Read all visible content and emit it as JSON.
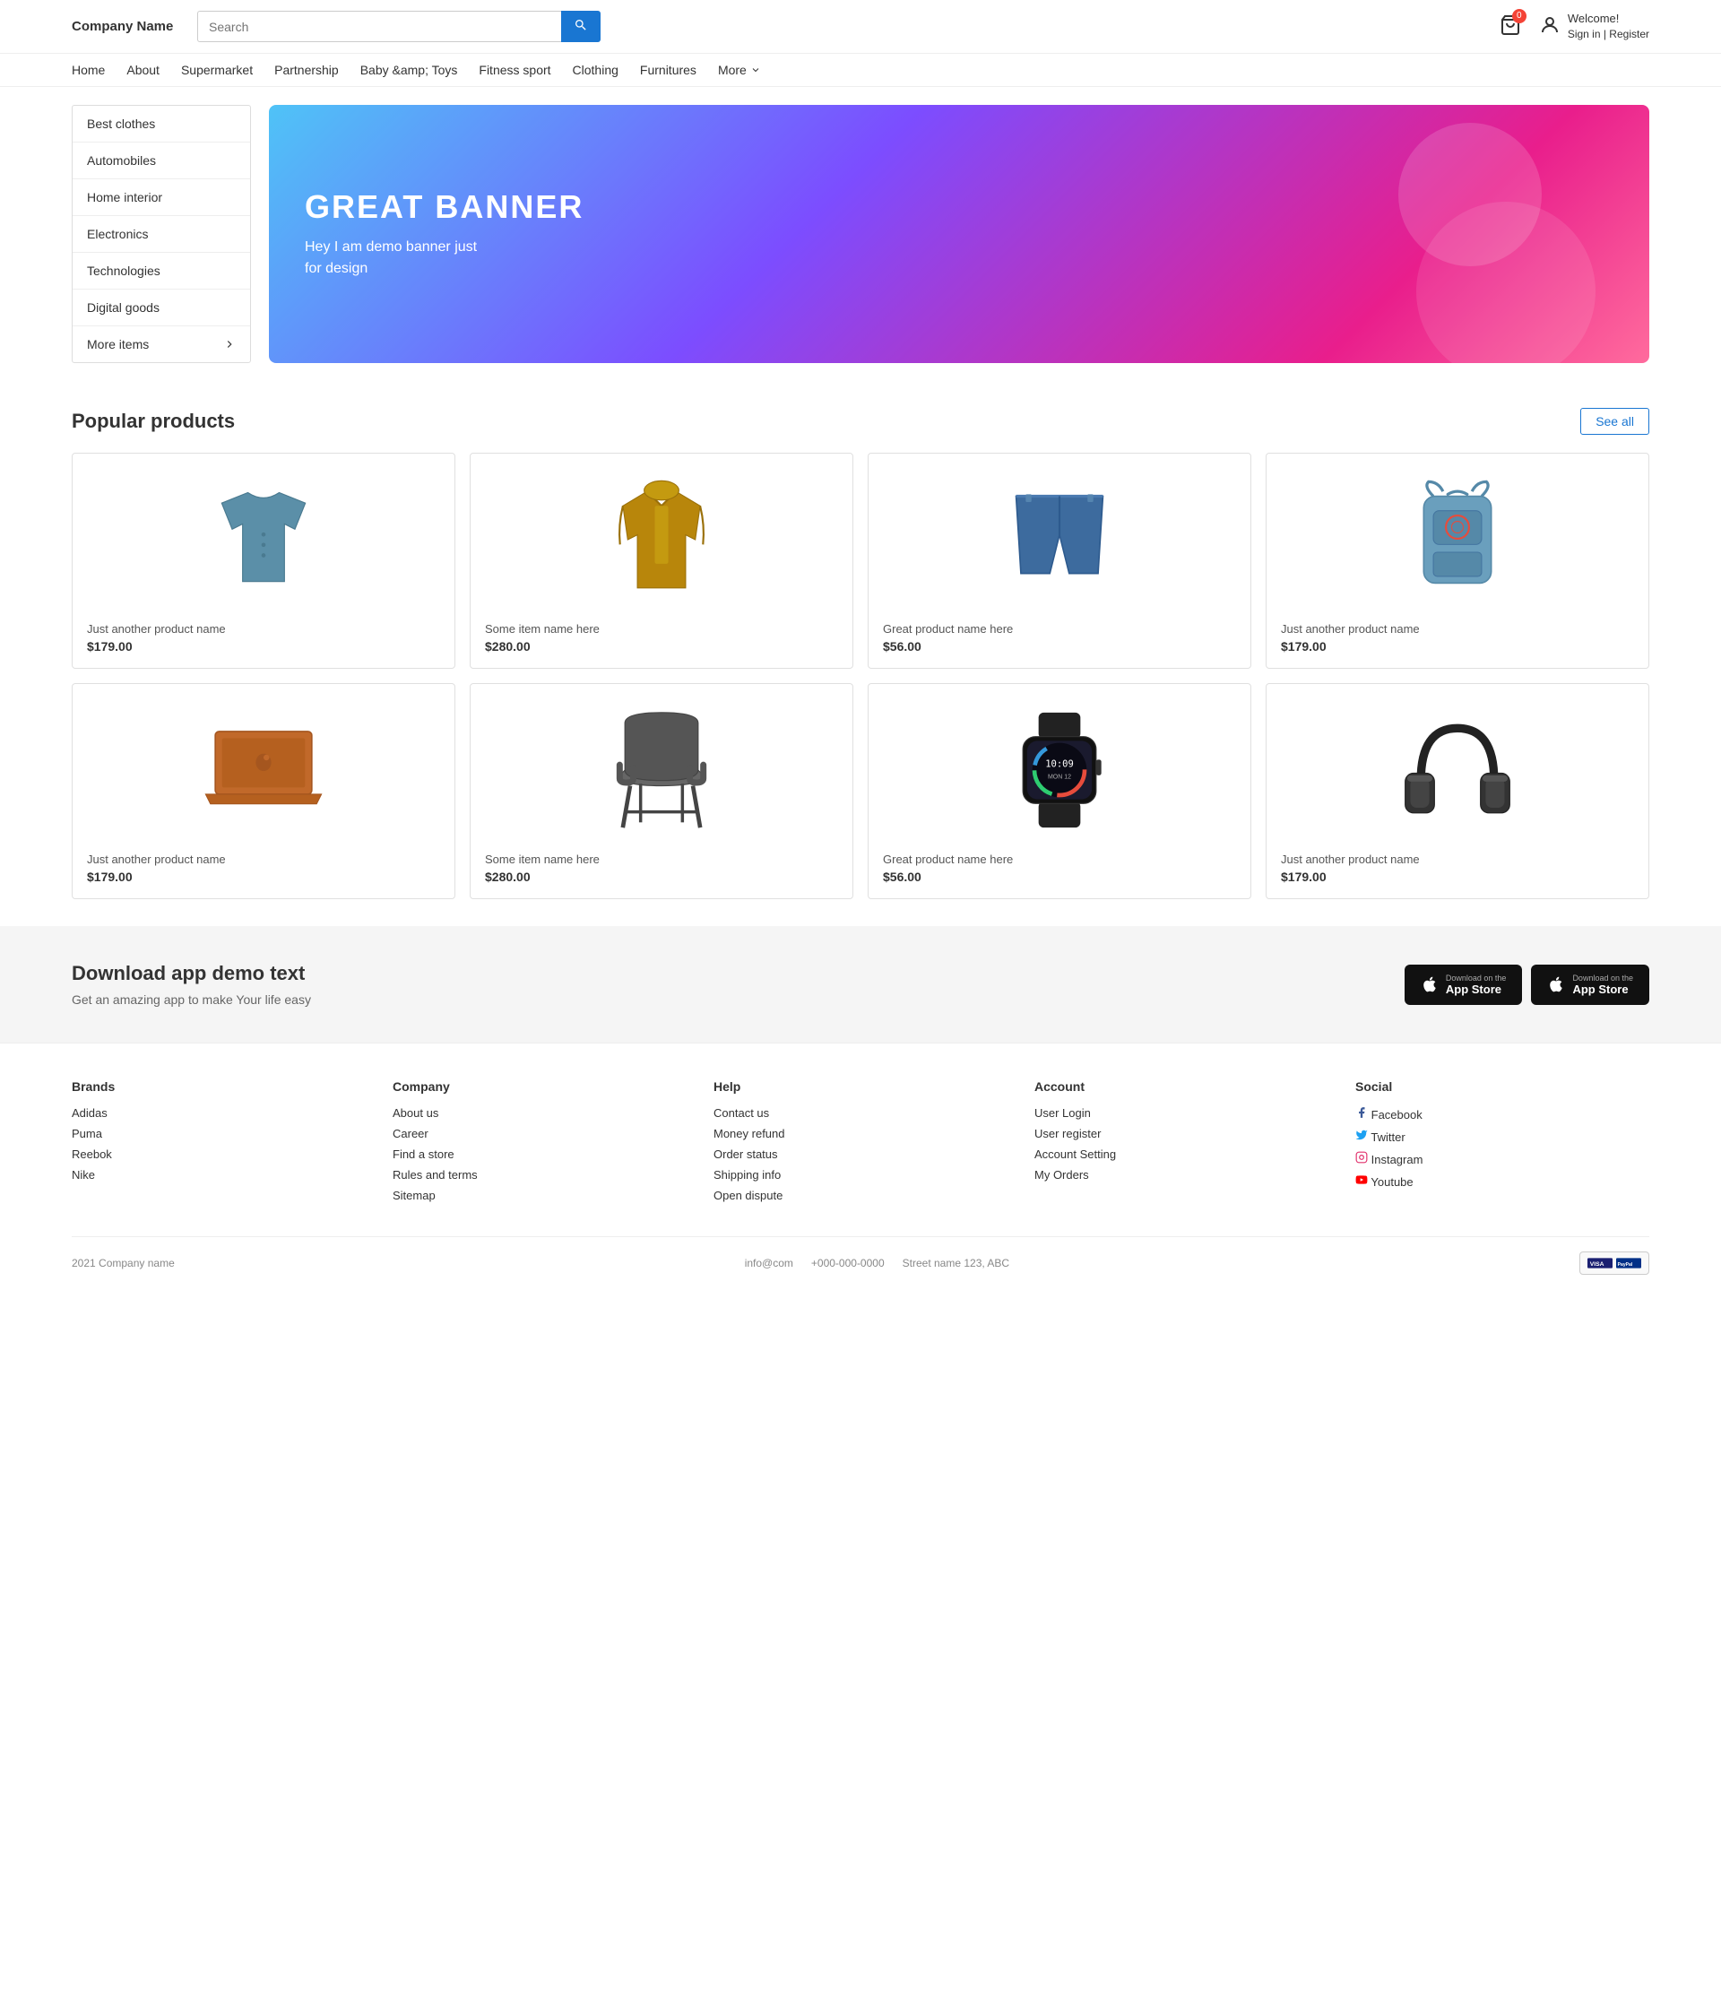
{
  "header": {
    "logo": "Company Name",
    "search_placeholder": "Search",
    "cart_count": "0",
    "welcome_greeting": "Welcome!",
    "sign_links": "Sign in | Register"
  },
  "nav": {
    "items": [
      {
        "label": "Home"
      },
      {
        "label": "About"
      },
      {
        "label": "Supermarket"
      },
      {
        "label": "Partnership"
      },
      {
        "label": "Baby &amp; Toys"
      },
      {
        "label": "Fitness sport"
      },
      {
        "label": "Clothing"
      },
      {
        "label": "Furnitures"
      },
      {
        "label": "More"
      }
    ]
  },
  "sidebar": {
    "items": [
      {
        "label": "Best clothes"
      },
      {
        "label": "Automobiles"
      },
      {
        "label": "Home interior"
      },
      {
        "label": "Electronics"
      },
      {
        "label": "Technologies"
      },
      {
        "label": "Digital goods"
      },
      {
        "label": "More items",
        "has_arrow": true
      }
    ]
  },
  "banner": {
    "title": "GREAT BANNER",
    "subtitle": "Hey I am demo banner just\nfor design"
  },
  "popular_products": {
    "title": "Popular products",
    "see_all_label": "See all",
    "products": [
      {
        "name": "Just another product name",
        "price": "$179.00",
        "type": "shirt"
      },
      {
        "name": "Some item name here",
        "price": "$280.00",
        "type": "jacket"
      },
      {
        "name": "Great product name here",
        "price": "$56.00",
        "type": "shorts"
      },
      {
        "name": "Just another product name",
        "price": "$179.00",
        "type": "backpack"
      },
      {
        "name": "Just another product name",
        "price": "$179.00",
        "type": "laptop"
      },
      {
        "name": "Some item name here",
        "price": "$280.00",
        "type": "chair"
      },
      {
        "name": "Great product name here",
        "price": "$56.00",
        "type": "watch"
      },
      {
        "name": "Just another product name",
        "price": "$179.00",
        "type": "headphone"
      }
    ]
  },
  "app_section": {
    "title": "Download app demo text",
    "subtitle": "Get an amazing app to make Your life easy",
    "btn1_top": "Download on the",
    "btn1_main": "App Store",
    "btn2_top": "Download on the",
    "btn2_main": "App Store"
  },
  "footer": {
    "brands": {
      "heading": "Brands",
      "links": [
        "Adidas",
        "Puma",
        "Reebok",
        "Nike"
      ]
    },
    "company": {
      "heading": "Company",
      "links": [
        "About us",
        "Career",
        "Find a store",
        "Rules and terms",
        "Sitemap"
      ]
    },
    "help": {
      "heading": "Help",
      "links": [
        "Contact us",
        "Money refund",
        "Order status",
        "Shipping info",
        "Open dispute"
      ]
    },
    "account": {
      "heading": "Account",
      "links": [
        "User Login",
        "User register",
        "Account Setting",
        "My Orders"
      ]
    },
    "social": {
      "heading": "Social",
      "links": [
        {
          "label": "Facebook",
          "icon": "facebook"
        },
        {
          "label": "Twitter",
          "icon": "twitter"
        },
        {
          "label": "Instagram",
          "icon": "instagram"
        },
        {
          "label": "Youtube",
          "icon": "youtube"
        }
      ]
    },
    "bottom": {
      "copyright": "2021 Company name",
      "email": "info@com",
      "phone": "+000-000-0000",
      "address": "Street name 123, ABC"
    }
  }
}
